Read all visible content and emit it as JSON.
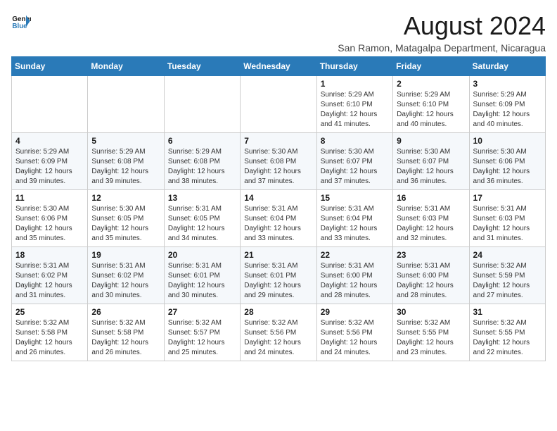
{
  "logo": {
    "text_general": "General",
    "text_blue": "Blue"
  },
  "title": "August 2024",
  "subtitle": "San Ramon, Matagalpa Department, Nicaragua",
  "days_of_week": [
    "Sunday",
    "Monday",
    "Tuesday",
    "Wednesday",
    "Thursday",
    "Friday",
    "Saturday"
  ],
  "weeks": [
    [
      {
        "day": "",
        "info": ""
      },
      {
        "day": "",
        "info": ""
      },
      {
        "day": "",
        "info": ""
      },
      {
        "day": "",
        "info": ""
      },
      {
        "day": "1",
        "info": "Sunrise: 5:29 AM\nSunset: 6:10 PM\nDaylight: 12 hours\nand 41 minutes."
      },
      {
        "day": "2",
        "info": "Sunrise: 5:29 AM\nSunset: 6:10 PM\nDaylight: 12 hours\nand 40 minutes."
      },
      {
        "day": "3",
        "info": "Sunrise: 5:29 AM\nSunset: 6:09 PM\nDaylight: 12 hours\nand 40 minutes."
      }
    ],
    [
      {
        "day": "4",
        "info": "Sunrise: 5:29 AM\nSunset: 6:09 PM\nDaylight: 12 hours\nand 39 minutes."
      },
      {
        "day": "5",
        "info": "Sunrise: 5:29 AM\nSunset: 6:08 PM\nDaylight: 12 hours\nand 39 minutes."
      },
      {
        "day": "6",
        "info": "Sunrise: 5:29 AM\nSunset: 6:08 PM\nDaylight: 12 hours\nand 38 minutes."
      },
      {
        "day": "7",
        "info": "Sunrise: 5:30 AM\nSunset: 6:08 PM\nDaylight: 12 hours\nand 37 minutes."
      },
      {
        "day": "8",
        "info": "Sunrise: 5:30 AM\nSunset: 6:07 PM\nDaylight: 12 hours\nand 37 minutes."
      },
      {
        "day": "9",
        "info": "Sunrise: 5:30 AM\nSunset: 6:07 PM\nDaylight: 12 hours\nand 36 minutes."
      },
      {
        "day": "10",
        "info": "Sunrise: 5:30 AM\nSunset: 6:06 PM\nDaylight: 12 hours\nand 36 minutes."
      }
    ],
    [
      {
        "day": "11",
        "info": "Sunrise: 5:30 AM\nSunset: 6:06 PM\nDaylight: 12 hours\nand 35 minutes."
      },
      {
        "day": "12",
        "info": "Sunrise: 5:30 AM\nSunset: 6:05 PM\nDaylight: 12 hours\nand 35 minutes."
      },
      {
        "day": "13",
        "info": "Sunrise: 5:31 AM\nSunset: 6:05 PM\nDaylight: 12 hours\nand 34 minutes."
      },
      {
        "day": "14",
        "info": "Sunrise: 5:31 AM\nSunset: 6:04 PM\nDaylight: 12 hours\nand 33 minutes."
      },
      {
        "day": "15",
        "info": "Sunrise: 5:31 AM\nSunset: 6:04 PM\nDaylight: 12 hours\nand 33 minutes."
      },
      {
        "day": "16",
        "info": "Sunrise: 5:31 AM\nSunset: 6:03 PM\nDaylight: 12 hours\nand 32 minutes."
      },
      {
        "day": "17",
        "info": "Sunrise: 5:31 AM\nSunset: 6:03 PM\nDaylight: 12 hours\nand 31 minutes."
      }
    ],
    [
      {
        "day": "18",
        "info": "Sunrise: 5:31 AM\nSunset: 6:02 PM\nDaylight: 12 hours\nand 31 minutes."
      },
      {
        "day": "19",
        "info": "Sunrise: 5:31 AM\nSunset: 6:02 PM\nDaylight: 12 hours\nand 30 minutes."
      },
      {
        "day": "20",
        "info": "Sunrise: 5:31 AM\nSunset: 6:01 PM\nDaylight: 12 hours\nand 30 minutes."
      },
      {
        "day": "21",
        "info": "Sunrise: 5:31 AM\nSunset: 6:01 PM\nDaylight: 12 hours\nand 29 minutes."
      },
      {
        "day": "22",
        "info": "Sunrise: 5:31 AM\nSunset: 6:00 PM\nDaylight: 12 hours\nand 28 minutes."
      },
      {
        "day": "23",
        "info": "Sunrise: 5:31 AM\nSunset: 6:00 PM\nDaylight: 12 hours\nand 28 minutes."
      },
      {
        "day": "24",
        "info": "Sunrise: 5:32 AM\nSunset: 5:59 PM\nDaylight: 12 hours\nand 27 minutes."
      }
    ],
    [
      {
        "day": "25",
        "info": "Sunrise: 5:32 AM\nSunset: 5:58 PM\nDaylight: 12 hours\nand 26 minutes."
      },
      {
        "day": "26",
        "info": "Sunrise: 5:32 AM\nSunset: 5:58 PM\nDaylight: 12 hours\nand 26 minutes."
      },
      {
        "day": "27",
        "info": "Sunrise: 5:32 AM\nSunset: 5:57 PM\nDaylight: 12 hours\nand 25 minutes."
      },
      {
        "day": "28",
        "info": "Sunrise: 5:32 AM\nSunset: 5:56 PM\nDaylight: 12 hours\nand 24 minutes."
      },
      {
        "day": "29",
        "info": "Sunrise: 5:32 AM\nSunset: 5:56 PM\nDaylight: 12 hours\nand 24 minutes."
      },
      {
        "day": "30",
        "info": "Sunrise: 5:32 AM\nSunset: 5:55 PM\nDaylight: 12 hours\nand 23 minutes."
      },
      {
        "day": "31",
        "info": "Sunrise: 5:32 AM\nSunset: 5:55 PM\nDaylight: 12 hours\nand 22 minutes."
      }
    ]
  ]
}
